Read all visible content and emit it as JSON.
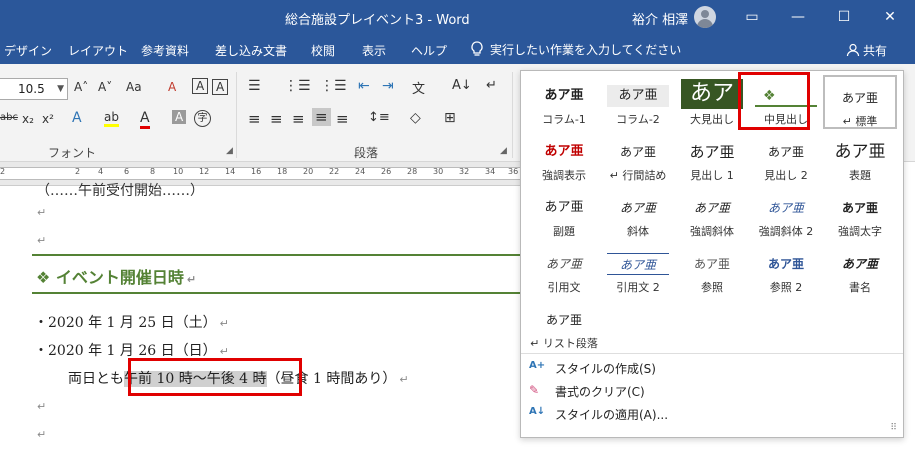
{
  "window": {
    "title": "総合施設プレイベント3 - Word",
    "user": "裕介 相澤",
    "minimize_glyph": "—",
    "restore_glyph": "❐",
    "maximize_glyph": "☐",
    "close_glyph": "✕",
    "ribbon_display_glyph": "▭"
  },
  "tabs": [
    "デザイン",
    "レイアウト",
    "参考資料",
    "差し込み文書",
    "校閲",
    "表示",
    "ヘルプ"
  ],
  "tell_me": "実行したい作業を入力してください",
  "share": "共有",
  "ribbon": {
    "font_size": "10.5",
    "groups": {
      "font": "フォント",
      "paragraph": "段落"
    },
    "glyphs": {
      "grow": "A˄",
      "shrink": "A˅",
      "case": "Aa",
      "clear": "A",
      "boxed": "A",
      "abc": "abc",
      "sub": "x₂",
      "sup": "x²",
      "effects": "A",
      "highlight": "ab",
      "fontcolor": "A",
      "shade": "A",
      "circled": "字",
      "bullets": "☰",
      "numbering": "⋮☰",
      "multilevel": "⋮☰",
      "outdent": "⇤",
      "indent": "⇥",
      "asian": "文",
      "sort": "A↓",
      "marks": "↵",
      "align_left": "≡",
      "align_center": "≡",
      "align_right": "≡",
      "justify": "≡",
      "distributed": "≡",
      "spacing": "↕≡",
      "fill": "◇",
      "borders": "⊞"
    }
  },
  "ruler": {
    "numbers": [
      "2",
      "2",
      "4",
      "6",
      "8",
      "10",
      "12",
      "14",
      "16",
      "18",
      "20",
      "22",
      "24",
      "26",
      "28",
      "30",
      "32",
      "34",
      "36"
    ]
  },
  "document": {
    "lines": [
      {
        "text": "・2020 年 1 月 25 日（土）"
      },
      {
        "text": "・2020 年 1 月 26 日（日）"
      }
    ],
    "heading": "❖ イベント開催日時",
    "line3_prefix": "両日とも",
    "line3_selected": "午前 10 時〜午後 4 時",
    "line3_suffix": "（昼食 1 時間あり）",
    "para_mark": "↵",
    "top_cut_text": "（……午前受付開始……）"
  },
  "gallery": {
    "styles": [
      {
        "preview": "あア亜",
        "name": "コラム-1"
      },
      {
        "preview": "あア亜",
        "name": "コラム-2"
      },
      {
        "preview": "あア",
        "name": "大見出し"
      },
      {
        "preview": "❖",
        "name": "中見出し"
      },
      {
        "preview": "あア亜",
        "name": "↵ 標準"
      },
      {
        "preview": "あア亜",
        "name": "強調表示"
      },
      {
        "preview": "あア亜",
        "name": "↵ 行間詰め"
      },
      {
        "preview": "あア亜",
        "name": "見出し 1"
      },
      {
        "preview": "あア亜",
        "name": "見出し 2"
      },
      {
        "preview": "あア亜",
        "name": "表題"
      },
      {
        "preview": "あア亜",
        "name": "副題"
      },
      {
        "preview": "あア亜",
        "name": "斜体"
      },
      {
        "preview": "あア亜",
        "name": "強調斜体"
      },
      {
        "preview": "あア亜",
        "name": "強調斜体 2"
      },
      {
        "preview": "あア亜",
        "name": "強調太字"
      },
      {
        "preview": "あア亜",
        "name": "引用文"
      },
      {
        "preview": "あア亜",
        "name": "引用文 2"
      },
      {
        "preview": "あア亜",
        "name": "参照"
      },
      {
        "preview": "あア亜",
        "name": "参照 2"
      },
      {
        "preview": "あア亜",
        "name": "書名"
      },
      {
        "preview": "あア亜",
        "name": "↵ リスト段落"
      }
    ],
    "commands": [
      {
        "label": "スタイルの作成(S)",
        "icon": "A+"
      },
      {
        "label": "書式のクリア(C)",
        "icon": "✎"
      },
      {
        "label": "スタイルの適用(A)...",
        "icon": "A↓"
      }
    ]
  },
  "colors": {
    "word_blue": "#2b579a",
    "heading_green": "#548235",
    "callout_red": "#e00000",
    "emphasis_red": "#c00000",
    "heading_blue": "#2f5597"
  }
}
